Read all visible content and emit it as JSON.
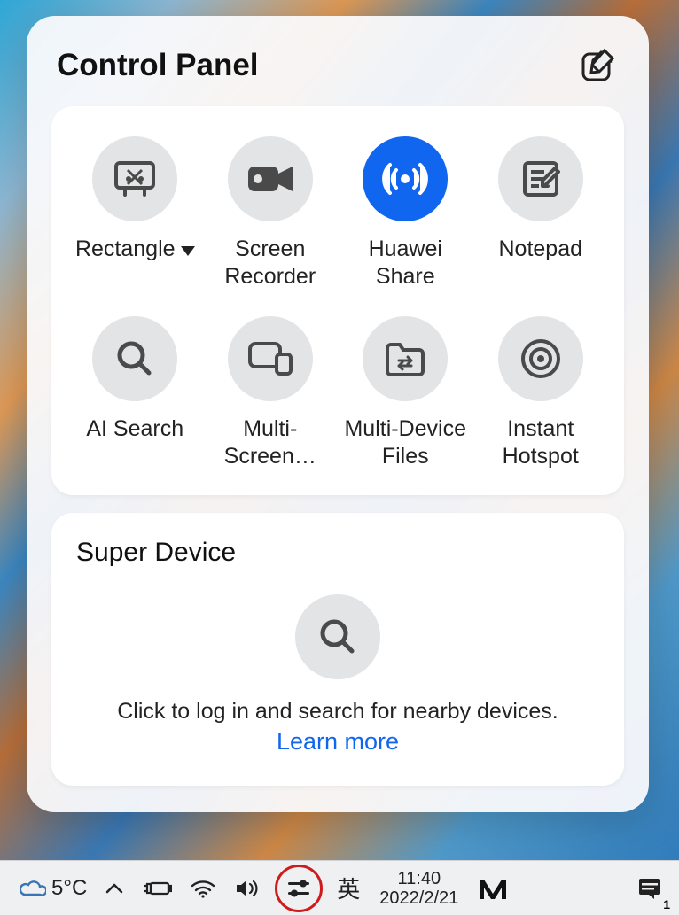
{
  "panel": {
    "title": "Control Panel",
    "tiles": [
      {
        "label": "Rectangle",
        "has_dropdown": true
      },
      {
        "label": "Screen Recorder"
      },
      {
        "label": "Huawei Share",
        "active": true
      },
      {
        "label": "Notepad"
      },
      {
        "label": "AI Search"
      },
      {
        "label": "Multi-Screen…"
      },
      {
        "label": "Multi-Device Files"
      },
      {
        "label": "Instant Hotspot"
      }
    ],
    "super_device": {
      "title": "Super Device",
      "prompt": "Click to log in and search for nearby devices.",
      "learn_more": "Learn more"
    }
  },
  "taskbar": {
    "temperature": "5°C",
    "ime": "英",
    "time": "11:40",
    "date": "2022/2/21",
    "notification_count": "1"
  }
}
